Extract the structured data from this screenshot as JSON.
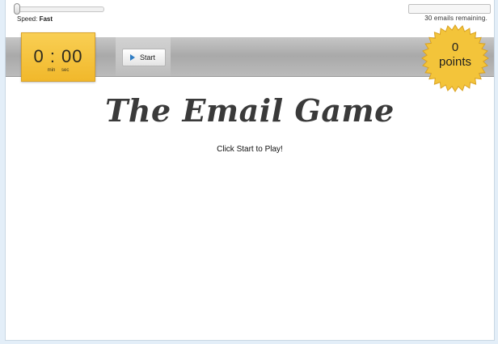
{
  "speed": {
    "label": "Speed:",
    "value": "Fast"
  },
  "emails": {
    "remaining_text": "30 emails remaining."
  },
  "timer": {
    "display": "0 : 00",
    "min_label": "min",
    "sec_label": "sec"
  },
  "start_button": {
    "label": "Start",
    "icon": "play-icon"
  },
  "points": {
    "value": "0",
    "label": "points"
  },
  "game": {
    "title": "The Email Game",
    "instruction": "Click Start to Play!"
  },
  "colors": {
    "timer_bg": "#f4c23a",
    "badge_bg": "#f3c43a",
    "play_icon": "#2f7dc4",
    "title_text": "#3a3a3a"
  }
}
